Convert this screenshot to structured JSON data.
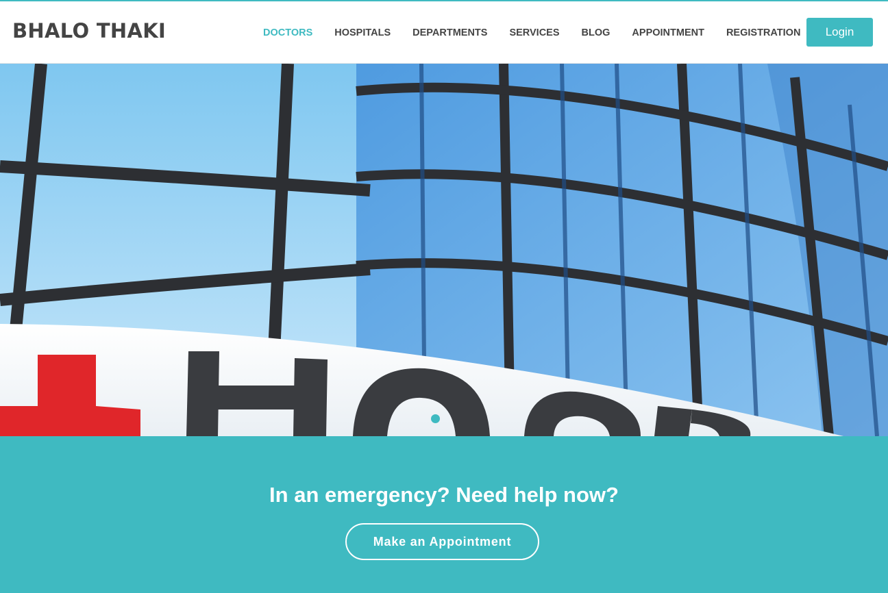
{
  "brand": {
    "name": "BHALO THAKI"
  },
  "nav": {
    "items": [
      {
        "label": "DOCTORS"
      },
      {
        "label": "HOSPITALS"
      },
      {
        "label": "DEPARTMENTS"
      },
      {
        "label": "SERVICES"
      },
      {
        "label": "BLOG"
      },
      {
        "label": "APPOINTMENT"
      },
      {
        "label": "REGISTRATION"
      }
    ],
    "active": "DOCTORS",
    "dropdown_icon": "chevron-down-icon",
    "login_label": "Login"
  },
  "hero": {
    "image": "hospital-building-photo",
    "slide_count": 1,
    "active_slide": 1
  },
  "cta": {
    "title": "In an emergency? Need help now?",
    "button_label": "Make an Appointment"
  },
  "colors": {
    "accent": "#3fbac1",
    "text": "#444444",
    "white": "#ffffff"
  }
}
